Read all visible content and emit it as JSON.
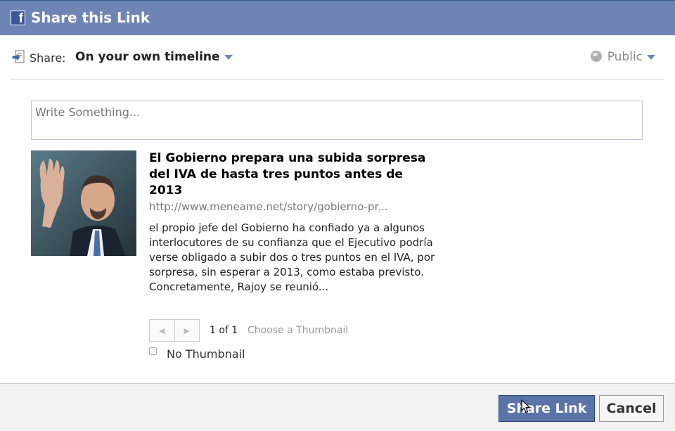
{
  "dialog": {
    "title": "Share this Link",
    "logo_letter": "f"
  },
  "share": {
    "label": "Share:",
    "target": "On your own timeline",
    "privacy": "Public"
  },
  "composer": {
    "placeholder": "Write Something..."
  },
  "link": {
    "title": "El Gobierno prepara una subida sorpresa del IVA de hasta tres puntos antes de 2013",
    "url": "http://www.meneame.net/story/gobierno-pr...",
    "description": "el propio jefe del Gobierno ha confiado ya a algunos interlocutores de su confianza que el Ejecutivo podría verse obligado a subir dos o tres puntos en el IVA, por sorpresa, sin esperar a 2013, como estaba previsto. Concretamente, Rajoy se reunió..."
  },
  "thumbnail": {
    "page_count": "1 of 1",
    "choose_label": "Choose a Thumbnail",
    "no_thumbnail_label": "No Thumbnail",
    "prev_icon": "◀",
    "next_icon": "▶"
  },
  "footer": {
    "share_button": "Share Link",
    "cancel_button": "Cancel"
  },
  "colors": {
    "header": "#6d84b4",
    "primary_button": "#5b74a8"
  }
}
